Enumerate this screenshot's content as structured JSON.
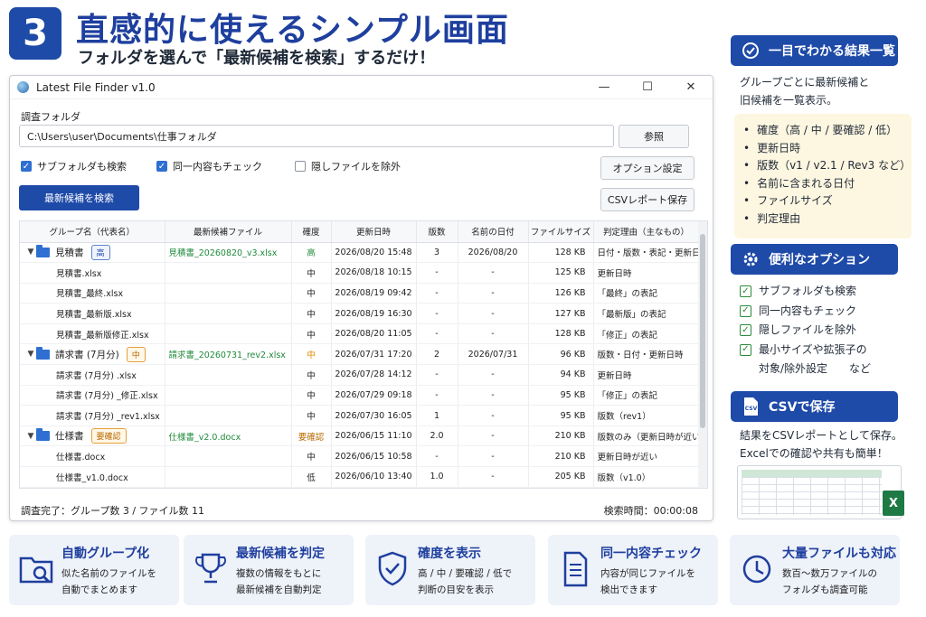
{
  "header": {
    "step": "3",
    "title": "直感的に使えるシンプル画面",
    "subtitle": "フォルダを選んで「最新候補を検索」するだけ！"
  },
  "window": {
    "title": "Latest File Finder v1.0",
    "controls": {
      "minimize": "—",
      "maximize": "☐",
      "close": "✕"
    },
    "folder_label": "調査フォルダ",
    "folder_value": "C:\\Users\\user\\Documents\\仕事フォルダ",
    "browse_button": "参照",
    "checkboxes": [
      {
        "label": "サブフォルダも検索",
        "checked": true
      },
      {
        "label": "同一内容もチェック",
        "checked": true
      },
      {
        "label": "隠しファイルを除外",
        "checked": false
      }
    ],
    "options_button": "オプション設定",
    "csv_button": "CSVレポート保存",
    "search_button": "最新候補を検索",
    "columns": [
      "グループ名（代表名）",
      "最新候補ファイル",
      "確度",
      "更新日時",
      "版数",
      "名前の日付",
      "ファイルサイズ",
      "判定理由（主なもの）"
    ],
    "groups": [
      {
        "name": "見積書",
        "badge": "高",
        "badge_type": "high",
        "file": "見積書_20260820_v3.xlsx",
        "confidence": "高",
        "updated": "2026/08/20 15:48",
        "version": "3",
        "name_date": "2026/08/20",
        "size": "128 KB",
        "reason": "日付・版数・表記・更新日時",
        "children": [
          {
            "file": "見積書.xlsx",
            "confidence": "中",
            "updated": "2026/08/18 10:15",
            "version": "-",
            "name_date": "-",
            "size": "125 KB",
            "reason": "更新日時"
          },
          {
            "file": "見積書_最終.xlsx",
            "confidence": "中",
            "updated": "2026/08/19 09:42",
            "version": "-",
            "name_date": "-",
            "size": "126 KB",
            "reason": "「最終」の表記"
          },
          {
            "file": "見積書_最新版.xlsx",
            "confidence": "中",
            "updated": "2026/08/19 16:30",
            "version": "-",
            "name_date": "-",
            "size": "127 KB",
            "reason": "「最新版」の表記"
          },
          {
            "file": "見積書_最新版修正.xlsx",
            "confidence": "中",
            "updated": "2026/08/20 11:05",
            "version": "-",
            "name_date": "-",
            "size": "128 KB",
            "reason": "「修正」の表記"
          }
        ]
      },
      {
        "name": "請求書 (7月分)",
        "badge": "中",
        "badge_type": "mid",
        "file": "請求書_20260731_rev2.xlsx",
        "confidence": "中",
        "updated": "2026/07/31 17:20",
        "version": "2",
        "name_date": "2026/07/31",
        "size": "96 KB",
        "reason": "版数・日付・更新日時",
        "children": [
          {
            "file": "請求書 (7月分) .xlsx",
            "confidence": "中",
            "updated": "2026/07/28 14:12",
            "version": "-",
            "name_date": "-",
            "size": "94 KB",
            "reason": "更新日時"
          },
          {
            "file": "請求書 (7月分) _修正.xlsx",
            "confidence": "中",
            "updated": "2026/07/29 09:18",
            "version": "-",
            "name_date": "-",
            "size": "95 KB",
            "reason": "「修正」の表記"
          },
          {
            "file": "請求書 (7月分) _rev1.xlsx",
            "confidence": "中",
            "updated": "2026/07/30 16:05",
            "version": "1",
            "name_date": "-",
            "size": "95 KB",
            "reason": "版数（rev1）"
          }
        ]
      },
      {
        "name": "仕様書",
        "badge": "要確認",
        "badge_type": "check",
        "file": "仕様書_v2.0.docx",
        "confidence": "要確認",
        "updated": "2026/06/15 11:10",
        "version": "2.0",
        "name_date": "-",
        "size": "210 KB",
        "reason": "版数のみ（更新日時が近い）",
        "children": [
          {
            "file": "仕様書.docx",
            "confidence": "中",
            "updated": "2026/06/15 10:58",
            "version": "-",
            "name_date": "-",
            "size": "210 KB",
            "reason": "更新日時が近い"
          },
          {
            "file": "仕様書_v1.0.docx",
            "confidence": "低",
            "updated": "2026/06/10 13:40",
            "version": "1.0",
            "name_date": "-",
            "size": "205 KB",
            "reason": "版数（v1.0）"
          }
        ]
      }
    ],
    "status": "調査完了：グループ数 3 / ファイル数 11",
    "elapsed": "検索時間：00:00:08"
  },
  "side": {
    "results": {
      "title": "一目でわかる結果一覧",
      "desc_lines": [
        "グループごとに最新候補と",
        "旧候補を一覧表示。"
      ],
      "bullets": [
        "確度（高 / 中 / 要確認 / 低）",
        "更新日時",
        "版数（v1 / v2.1 / Rev3 など）",
        "名前に含まれる日付",
        "ファイルサイズ",
        "判定理由"
      ]
    },
    "options": {
      "title": "便利なオプション",
      "items": [
        "サブフォルダも検索",
        "同一内容もチェック",
        "隠しファイルを除外",
        "最小サイズや拡張子の\n対象/除外設定　　など"
      ]
    },
    "csv": {
      "title": "CSVで保存",
      "icon_text": "CSV",
      "desc_lines": [
        "結果をCSVレポートとして保存。",
        "Excelでの確認や共有も簡単！"
      ],
      "excel_icon": "X"
    }
  },
  "features": [
    {
      "icon": "folder-search-icon",
      "title": "自動グループ化",
      "desc": "似た名前のファイルを\n自動でまとめます"
    },
    {
      "icon": "trophy-icon",
      "title": "最新候補を判定",
      "desc": "複数の情報をもとに\n最新候補を自動判定"
    },
    {
      "icon": "shield-check-icon",
      "title": "確度を表示",
      "desc": "高 / 中 / 要確認 / 低で\n判断の目安を表示"
    },
    {
      "icon": "document-icon",
      "title": "同一内容チェック",
      "desc": "内容が同じファイルを\n検出できます"
    },
    {
      "icon": "clock-icon",
      "title": "大量ファイルも対応",
      "desc": "数百〜数万ファイルの\nフォルダも調査可能"
    }
  ],
  "colors": {
    "primary": "#1e4aa8",
    "high": "#1f8a3b",
    "mid": "#e08a00",
    "card_bg": "#eef2f9"
  }
}
